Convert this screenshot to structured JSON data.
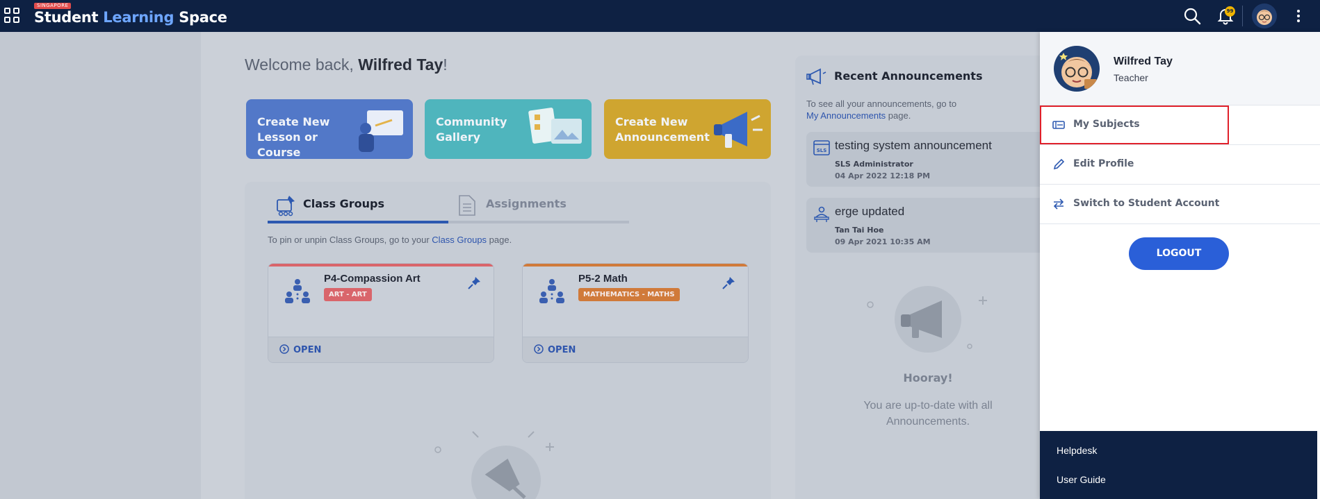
{
  "topbar": {
    "logo_tag": "SINGAPORE",
    "logo_part1": "Student ",
    "logo_part2": "Learning",
    "logo_part3": " Space",
    "notification_count": "99"
  },
  "welcome": {
    "prefix": "Welcome back, ",
    "name": "Wilfred Tay",
    "suffix": "!"
  },
  "quick_actions": [
    {
      "label": "Create New Lesson or Course"
    },
    {
      "label": "Community Gallery"
    },
    {
      "label": "Create New Announcement"
    }
  ],
  "tabs": [
    {
      "label": "Class Groups",
      "active": true
    },
    {
      "label": "Assignments",
      "active": false
    }
  ],
  "pin_note": {
    "before": "To pin or unpin Class Groups, go to your ",
    "link": "Class Groups",
    "after": " page."
  },
  "class_groups": [
    {
      "name": "P4-Compassion Art",
      "subject": "ART - ART",
      "color": "#d9656b",
      "open_label": "OPEN"
    },
    {
      "name": "P5-2 Math",
      "subject": "MATHEMATICS - MATHS",
      "color": "#d07a3a",
      "open_label": "OPEN"
    }
  ],
  "announcements": {
    "title": "Recent Announcements",
    "note_before": "To see all your announcements, go to",
    "note_link": "My Announcements",
    "note_after": " page.",
    "items": [
      {
        "title": "testing system announcement",
        "author": "SLS Administrator",
        "date": "04 Apr 2022 12:18 PM"
      },
      {
        "title": "erge updated",
        "author": "Tan Tai Hoe",
        "date": "09 Apr 2021 10:35 AM"
      }
    ],
    "empty_title": "Hooray!",
    "empty_text": "You are up-to-date with all Announcements."
  },
  "drawer": {
    "name": "Wilfred Tay",
    "role": "Teacher",
    "menu": [
      {
        "label": "My Subjects",
        "icon": "subjects-icon"
      },
      {
        "label": "Edit Profile",
        "icon": "pencil-icon"
      },
      {
        "label": "Switch to Student Account",
        "icon": "switch-icon"
      }
    ],
    "logout": "LOGOUT",
    "footer": [
      "Helpdesk",
      "User Guide"
    ]
  },
  "colors": {
    "navy": "#0e2143",
    "accent_blue": "#2a5fd8",
    "highlight_red": "#e0202a"
  }
}
